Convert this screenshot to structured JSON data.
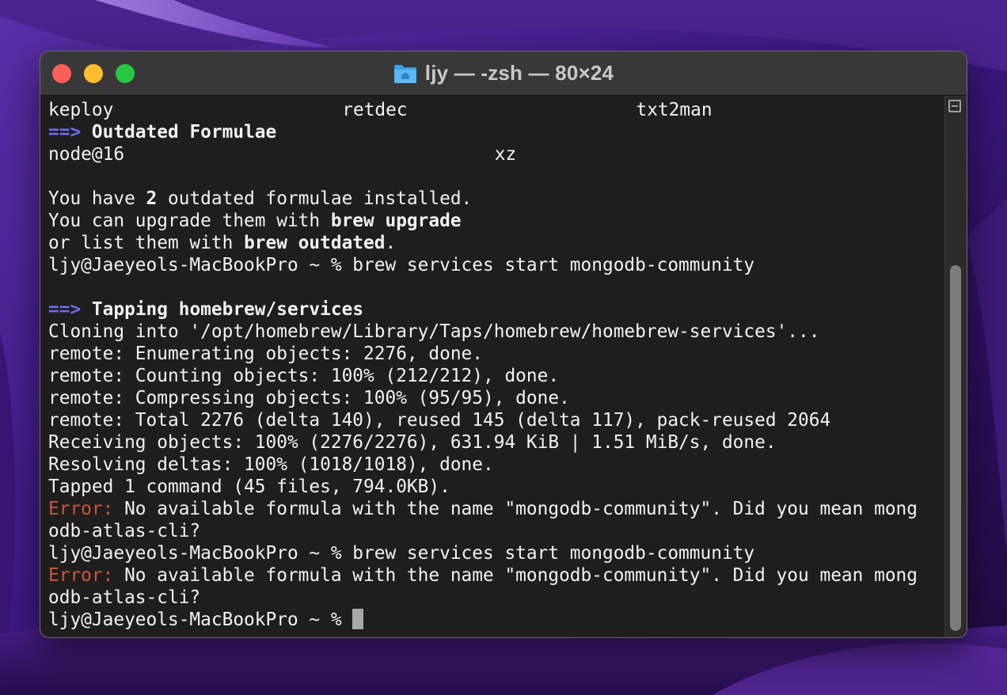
{
  "window": {
    "title": "ljy — -zsh — 80×24"
  },
  "terminal": {
    "lines": [
      {
        "kind": "cols",
        "cols": [
          "keploy",
          "retdec",
          "txt2man"
        ]
      },
      {
        "kind": "heading",
        "arrow": "==>",
        "text": "Outdated Formulae"
      },
      {
        "kind": "cols2",
        "cols": [
          "node@16",
          "xz"
        ]
      },
      {
        "kind": "blank"
      },
      {
        "kind": "segments",
        "segments": [
          {
            "text": "You have ",
            "style": "normal"
          },
          {
            "text": "2",
            "style": "bold"
          },
          {
            "text": " outdated formulae installed.",
            "style": "normal"
          }
        ]
      },
      {
        "kind": "segments",
        "segments": [
          {
            "text": "You can upgrade them with ",
            "style": "normal"
          },
          {
            "text": "brew upgrade",
            "style": "bold"
          }
        ]
      },
      {
        "kind": "segments",
        "segments": [
          {
            "text": "or list them with ",
            "style": "normal"
          },
          {
            "text": "brew outdated",
            "style": "bold"
          },
          {
            "text": ".",
            "style": "normal"
          }
        ]
      },
      {
        "kind": "plain",
        "text": "ljy@Jaeyeols-MacBookPro ~ % brew services start mongodb-community"
      },
      {
        "kind": "blank"
      },
      {
        "kind": "heading",
        "arrow": "==>",
        "text": "Tapping homebrew/services"
      },
      {
        "kind": "plain",
        "text": "Cloning into '/opt/homebrew/Library/Taps/homebrew/homebrew-services'..."
      },
      {
        "kind": "plain",
        "text": "remote: Enumerating objects: 2276, done."
      },
      {
        "kind": "plain",
        "text": "remote: Counting objects: 100% (212/212), done."
      },
      {
        "kind": "plain",
        "text": "remote: Compressing objects: 100% (95/95), done."
      },
      {
        "kind": "plain",
        "text": "remote: Total 2276 (delta 140), reused 145 (delta 117), pack-reused 2064"
      },
      {
        "kind": "plain",
        "text": "Receiving objects: 100% (2276/2276), 631.94 KiB | 1.51 MiB/s, done."
      },
      {
        "kind": "plain",
        "text": "Resolving deltas: 100% (1018/1018), done."
      },
      {
        "kind": "plain",
        "text": "Tapped 1 command (45 files, 794.0KB)."
      },
      {
        "kind": "error",
        "label": "Error:",
        "text": " No available formula with the name \"mongodb-community\". Did you mean mong"
      },
      {
        "kind": "plain",
        "text": "odb-atlas-cli?"
      },
      {
        "kind": "marked",
        "left": "[",
        "text": "ljy@Jaeyeols-MacBookPro ~ % brew services start mongodb-community",
        "right": "]"
      },
      {
        "kind": "error",
        "label": "Error:",
        "text": " No available formula with the name \"mongodb-community\". Did you mean mong"
      },
      {
        "kind": "plain",
        "text": "odb-atlas-cli?"
      },
      {
        "kind": "prompt",
        "text": "ljy@Jaeyeols-MacBookPro ~ % "
      }
    ]
  },
  "icons": {
    "folder": "home-folder-icon",
    "split": "split-pane-icon"
  },
  "colors": {
    "arrow": "#6b6bf5",
    "error": "#d0553a",
    "close": "#fe5f57",
    "minimize": "#febc2e",
    "maximize": "#28c840"
  }
}
